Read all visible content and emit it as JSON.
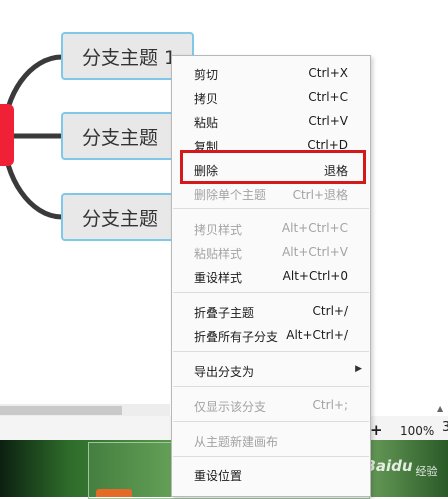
{
  "mindmap": {
    "topics": [
      "分支主题 1",
      "分支主题",
      "分支主题"
    ]
  },
  "context_menu": {
    "items": [
      {
        "label": "剪切",
        "shortcut": "Ctrl+X",
        "enabled": true
      },
      {
        "label": "拷贝",
        "shortcut": "Ctrl+C",
        "enabled": true
      },
      {
        "label": "粘贴",
        "shortcut": "Ctrl+V",
        "enabled": true
      },
      {
        "label": "复制",
        "shortcut": "Ctrl+D",
        "enabled": true
      },
      {
        "label": "删除",
        "shortcut": "退格",
        "enabled": true
      },
      {
        "label": "删除单个主题",
        "shortcut": "Ctrl+退格",
        "enabled": false
      },
      {
        "label": "拷贝样式",
        "shortcut": "Alt+Ctrl+C",
        "enabled": false
      },
      {
        "label": "粘贴样式",
        "shortcut": "Alt+Ctrl+V",
        "enabled": false
      },
      {
        "label": "重设样式",
        "shortcut": "Alt+Ctrl+0",
        "enabled": true
      },
      {
        "label": "折叠子主题",
        "shortcut": "Ctrl+/",
        "enabled": true
      },
      {
        "label": "折叠所有子分支",
        "shortcut": "Alt+Ctrl+/",
        "enabled": true
      },
      {
        "label": "导出分支为",
        "shortcut": "",
        "enabled": true
      },
      {
        "label": "仅显示该分支",
        "shortcut": "Ctrl+;",
        "enabled": false
      },
      {
        "label": "从主题新建画布",
        "shortcut": "",
        "enabled": false
      },
      {
        "label": "重设位置",
        "shortcut": "",
        "enabled": true
      }
    ]
  },
  "statusbar": {
    "zoom_plus": "+",
    "zoom_value": "100%",
    "extra": "3"
  },
  "watermark": {
    "paw": "🐾",
    "text": "Baidu",
    "sub": "经验"
  },
  "colors": {
    "root": "#f02036",
    "topic_border": "#7ec8ea",
    "highlight": "#d3191c"
  }
}
